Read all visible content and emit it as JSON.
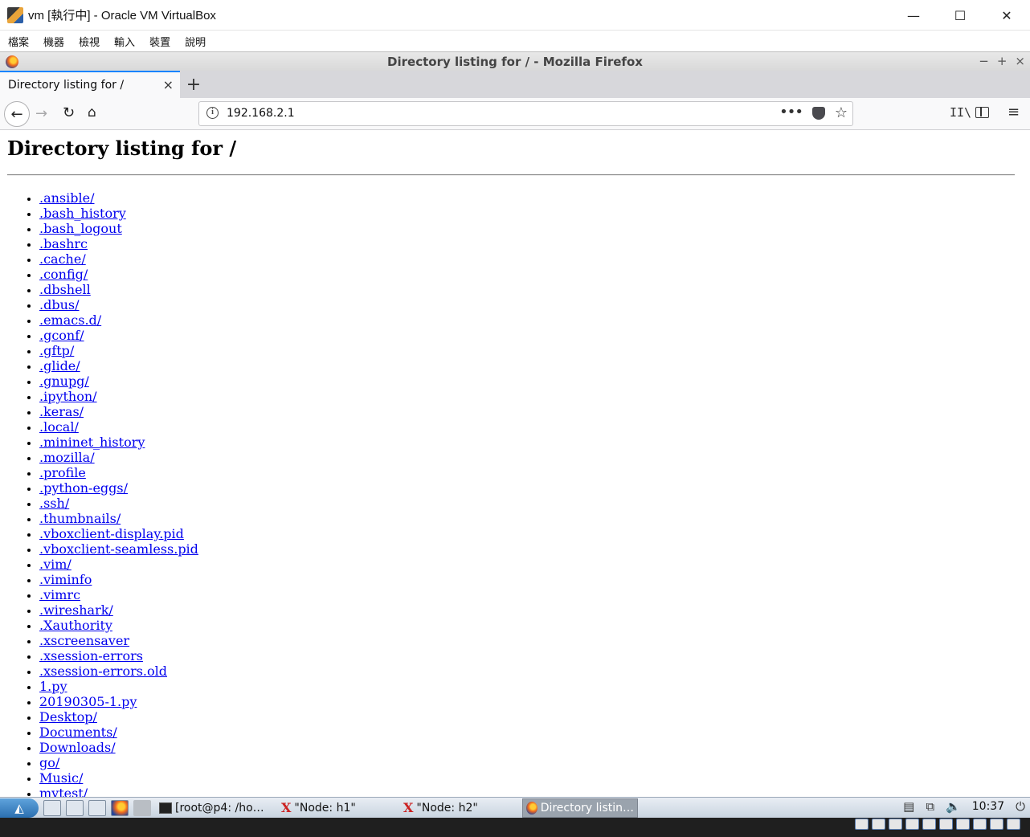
{
  "vbox": {
    "title": "vm [執行中] - Oracle VM VirtualBox",
    "window_controls": {
      "minimize": "—",
      "maximize": "☐",
      "close": "✕"
    },
    "menu": [
      "檔案",
      "機器",
      "檢視",
      "輸入",
      "裝置",
      "說明"
    ]
  },
  "firefox": {
    "window_title": "Directory listing for / - Mozilla Firefox",
    "title_controls": [
      "−",
      "+",
      "×"
    ],
    "tab": {
      "label": "Directory listing for /",
      "close": "×"
    },
    "new_tab": "+",
    "nav": {
      "back": "←",
      "forward": "→",
      "reload": "↻",
      "home": "⌂",
      "more": "•••",
      "star": "☆",
      "library": "II\\",
      "menu": "≡"
    },
    "url": "192.168.2.1"
  },
  "page": {
    "heading": "Directory listing for /",
    "entries": [
      ".ansible/",
      ".bash_history",
      ".bash_logout",
      ".bashrc",
      ".cache/",
      ".config/",
      ".dbshell",
      ".dbus/",
      ".emacs.d/",
      ".gconf/",
      ".gftp/",
      ".glide/",
      ".gnupg/",
      ".ipython/",
      ".keras/",
      ".local/",
      ".mininet_history",
      ".mozilla/",
      ".profile",
      ".python-eggs/",
      ".ssh/",
      ".thumbnails/",
      ".vboxclient-display.pid",
      ".vboxclient-seamless.pid",
      ".vim/",
      ".viminfo",
      ".vimrc",
      ".wireshark/",
      ".Xauthority",
      ".xscreensaver",
      ".xsession-errors",
      ".xsession-errors.old",
      "1.py",
      "20190305-1.py",
      "Desktop/",
      "Documents/",
      "Downloads/",
      "go/",
      "Music/",
      "mytest/"
    ]
  },
  "taskbar": {
    "tasks": [
      {
        "label": "[root@p4: /ho…",
        "icon": "terminal-icon"
      },
      {
        "label": "\"Node: h1\"",
        "icon": "x-icon"
      },
      {
        "label": "\"Node: h2\"",
        "icon": "x-icon"
      },
      {
        "label": "Directory listin…",
        "icon": "firefox-icon",
        "active": true
      }
    ],
    "clock": "10:37"
  },
  "colors": {
    "link": "#0000ee",
    "tab_accent": "#0a84ff",
    "taskbar": "#c9d4e0"
  }
}
